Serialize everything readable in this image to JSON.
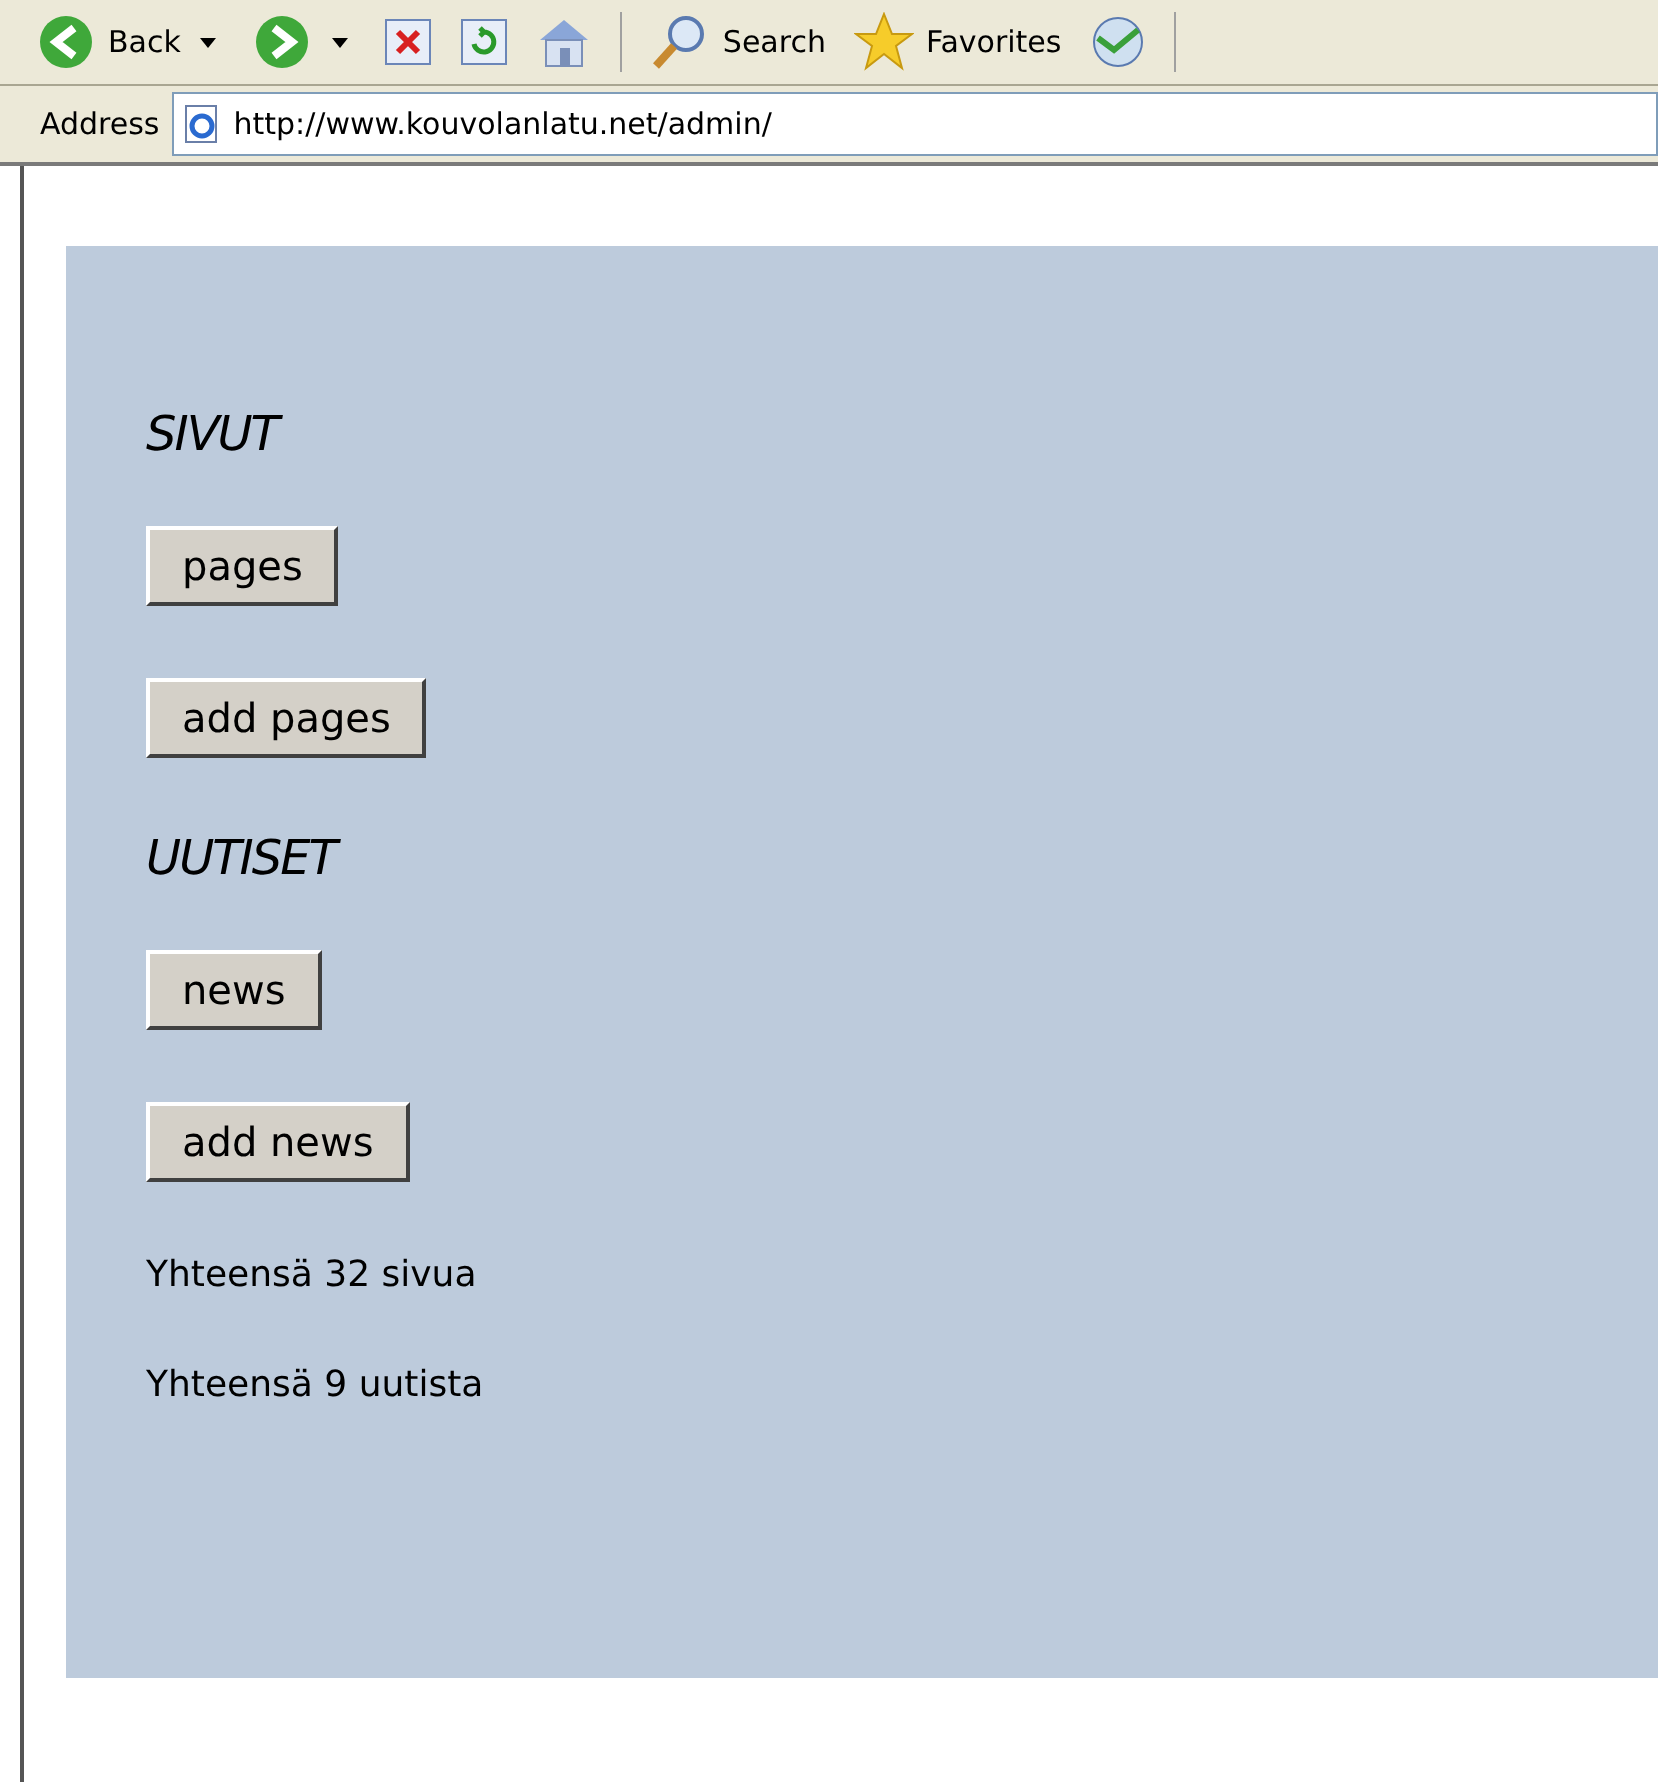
{
  "toolbar": [
    {
      "kind": "back",
      "label": "Back"
    },
    {
      "kind": "forward"
    },
    {
      "kind": "stop"
    },
    {
      "kind": "refresh"
    },
    {
      "kind": "home"
    },
    {
      "kind": "search",
      "label": "Search"
    },
    {
      "kind": "favorites",
      "label": "Favorites"
    },
    {
      "kind": "media"
    }
  ],
  "address_bar": {
    "label": "Address",
    "url": "http://www.kouvolanlatu.net/admin/"
  },
  "content": [
    {
      "kind": "heading",
      "text": "SIVUT"
    },
    {
      "kind": "button",
      "text": "pages"
    },
    {
      "kind": "button",
      "text": "add pages"
    },
    {
      "kind": "heading",
      "text": "UUTISET"
    },
    {
      "kind": "button",
      "text": "news"
    },
    {
      "kind": "button",
      "text": "add news"
    },
    {
      "kind": "text",
      "text": "Yhteensä 32 sivua"
    },
    {
      "kind": "text",
      "text": "Yhteensä 9 uutista"
    }
  ]
}
